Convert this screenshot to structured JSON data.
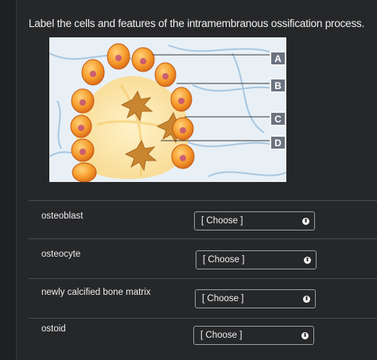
{
  "question": {
    "title": "Label the cells and features of the intramembranous ossification process."
  },
  "figure": {
    "callouts": [
      "A",
      "B",
      "C",
      "D"
    ]
  },
  "rows": [
    {
      "label": "osteoblast",
      "selected": "[ Choose ]"
    },
    {
      "label": "osteocyte",
      "selected": "[ Choose ]"
    },
    {
      "label": "newly calcified bone matrix",
      "selected": "[ Choose ]"
    },
    {
      "label": "ostoid",
      "selected": "[ Choose ]"
    }
  ]
}
